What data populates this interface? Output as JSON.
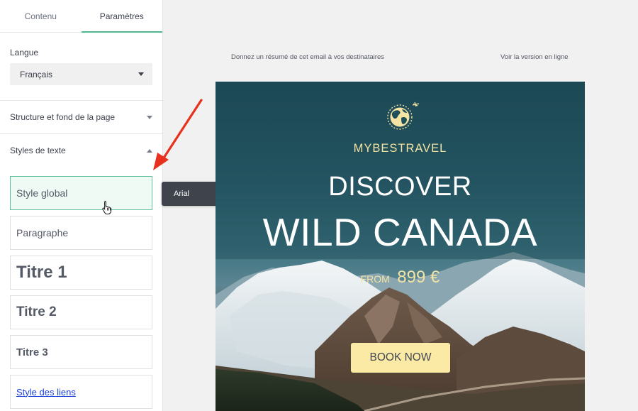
{
  "sidebar": {
    "tabs": [
      {
        "label": "Contenu",
        "active": false
      },
      {
        "label": "Paramètres",
        "active": true
      }
    ],
    "language": {
      "label": "Langue",
      "value": "Français"
    },
    "page_structure": {
      "label": "Structure et fond de la page",
      "expanded": false
    },
    "text_styles": {
      "label": "Styles de texte",
      "expanded": true,
      "items": [
        {
          "label": "Style global",
          "selected": true
        },
        {
          "label": "Paragraphe",
          "selected": false
        },
        {
          "label": "Titre 1",
          "selected": false
        },
        {
          "label": "Titre 2",
          "selected": false
        },
        {
          "label": "Titre 3",
          "selected": false
        },
        {
          "label": "Style des liens",
          "selected": false
        }
      ]
    }
  },
  "font_toolbar": {
    "font": "Arial",
    "icons": [
      "chevron-down-icon",
      "font-color-icon"
    ]
  },
  "email": {
    "preheader_text": "Donnez un résumé de cet email à vos destinataires",
    "view_online": "Voir la version en ligne",
    "hero": {
      "brand": "MYBESTRAVEL",
      "headline_1": "DISCOVER",
      "headline_2": "WILD CANADA",
      "price_prefix": "FROM",
      "price": "899 €",
      "cta": "BOOK NOW"
    }
  },
  "colors": {
    "accent_green": "#52b68f",
    "brand_yellow": "#f4e3a3",
    "cta_bg": "#fbeaa6",
    "toolbar_bg": "#3f434c",
    "link_blue": "#1a3fd6",
    "annotation_red": "#e8301f"
  }
}
